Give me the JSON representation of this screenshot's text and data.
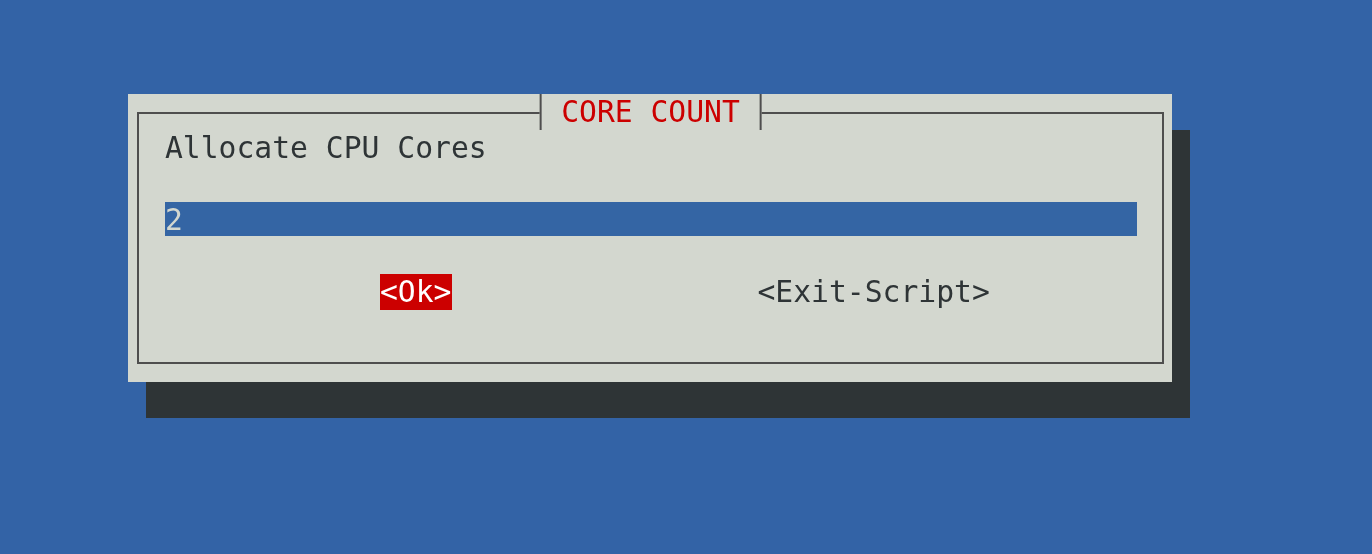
{
  "dialog": {
    "title": "CORE COUNT",
    "prompt": "Allocate CPU Cores",
    "input": {
      "value": "2"
    },
    "buttons": [
      {
        "label": "<Ok>",
        "selected": true
      },
      {
        "label": "<Exit-Script>",
        "selected": false
      }
    ]
  }
}
